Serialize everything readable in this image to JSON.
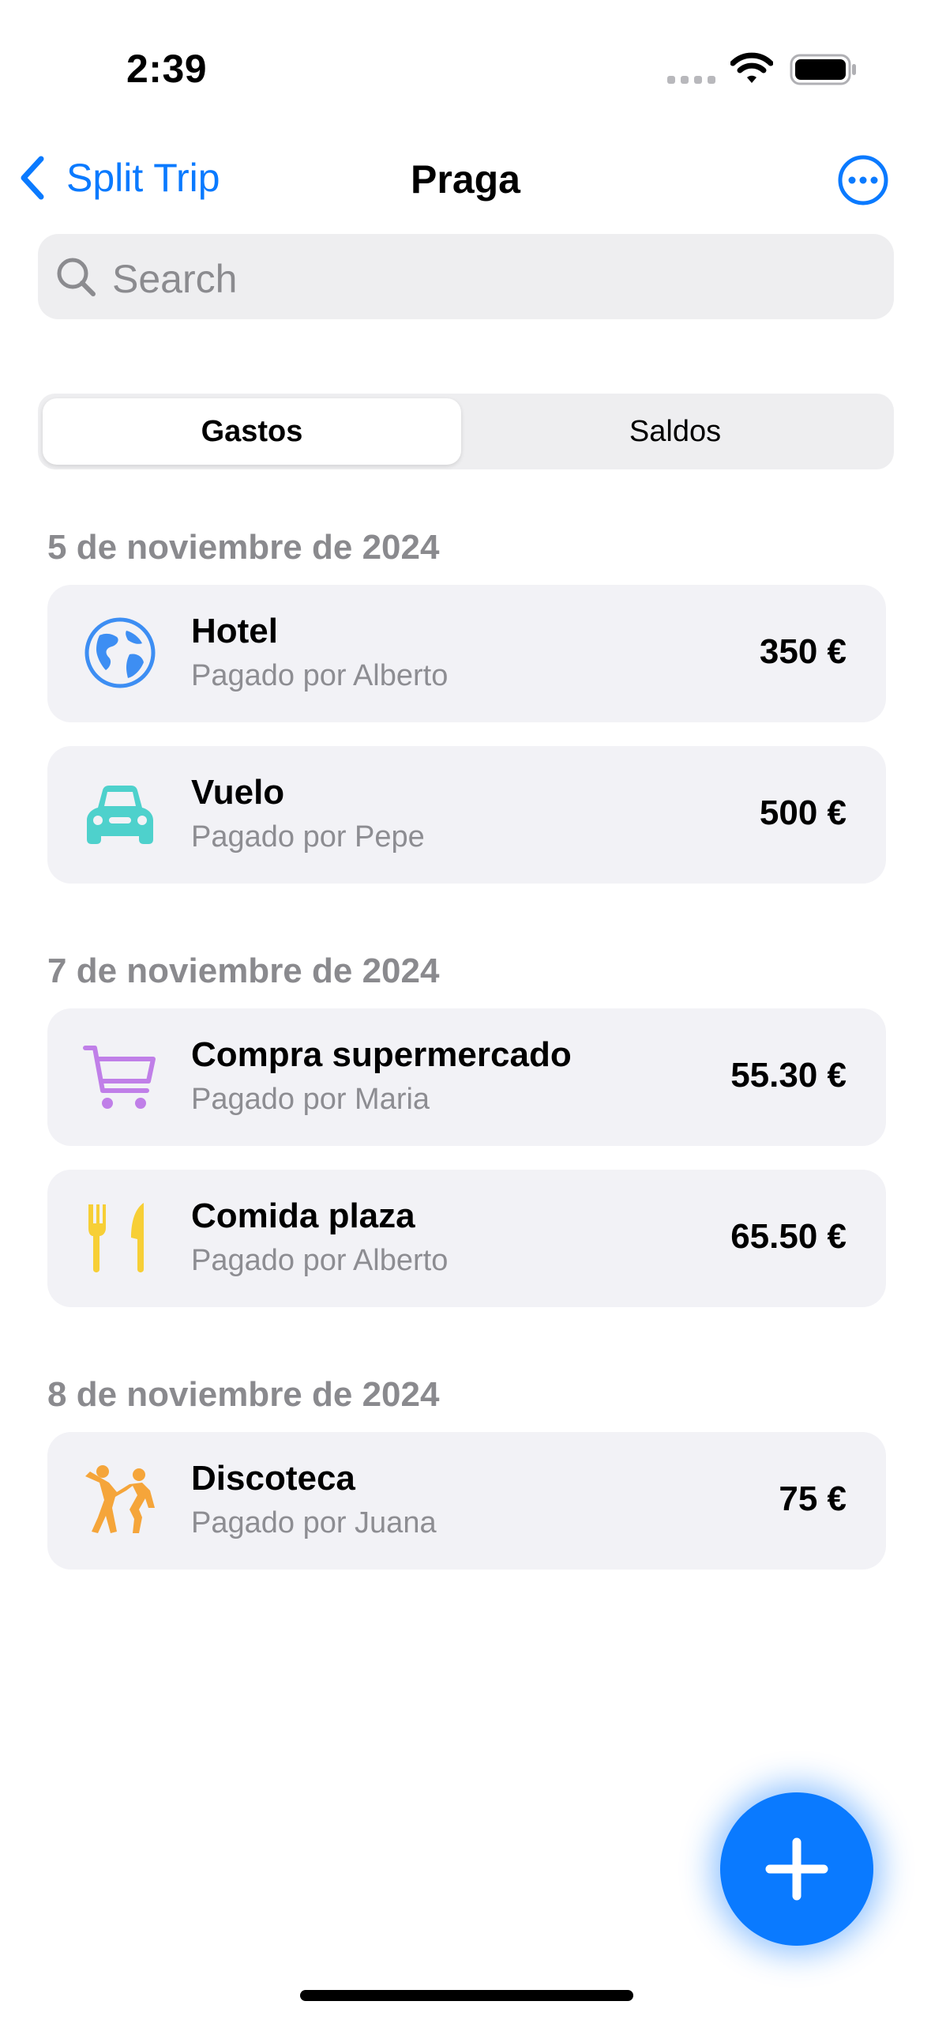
{
  "status_bar": {
    "time": "2:39"
  },
  "nav": {
    "back_label": "Split Trip",
    "title": "Praga"
  },
  "search": {
    "placeholder": "Search"
  },
  "segments": [
    {
      "label": "Gastos",
      "selected": true
    },
    {
      "label": "Saldos",
      "selected": false
    }
  ],
  "sections": [
    {
      "date": "5 de noviembre de 2024",
      "items": [
        {
          "icon": "globe-icon",
          "icon_color": "#3d8ef3",
          "title": "Hotel",
          "subtitle": "Pagado por Alberto",
          "amount": "350 €"
        },
        {
          "icon": "car-icon",
          "icon_color": "#4ed1cc",
          "title": "Vuelo",
          "subtitle": "Pagado por Pepe",
          "amount": "500 €"
        }
      ]
    },
    {
      "date": "7 de noviembre de 2024",
      "items": [
        {
          "icon": "cart-icon",
          "icon_color": "#c07fe8",
          "title": "Compra supermercado",
          "subtitle": "Pagado por Maria",
          "amount": "55.30 €"
        },
        {
          "icon": "fork-knife-icon",
          "icon_color": "#f7cf36",
          "title": "Comida plaza",
          "subtitle": "Pagado por Alberto",
          "amount": "65.50 €"
        }
      ]
    },
    {
      "date": "8 de noviembre de 2024",
      "items": [
        {
          "icon": "dancing-figures-icon",
          "icon_color": "#f5a53a",
          "title": "Discoteca",
          "subtitle": "Pagado por Juana",
          "amount": "75 €"
        }
      ]
    }
  ],
  "colors": {
    "accent": "#0a7aff",
    "card_bg": "#f2f2f6"
  },
  "fab": {
    "icon": "plus-icon"
  }
}
